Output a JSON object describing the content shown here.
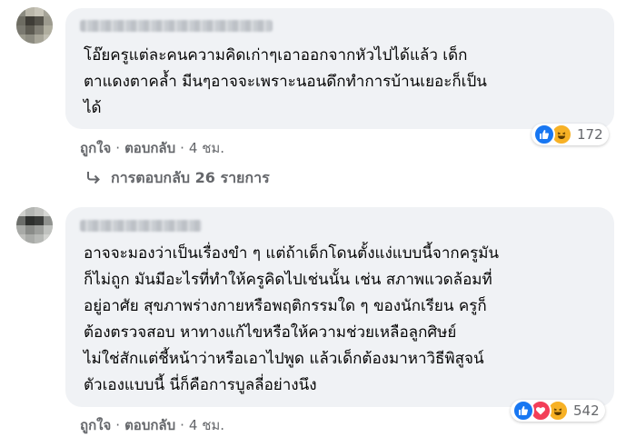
{
  "comments": [
    {
      "text": "โอ๊ยครูแต่ละคนความคิดเก่าๆเอาออกจากหัวไปได้แล้ว เด็ก\nตาแดงตาคล้ำ มีนๆอาจจะเพราะนอนดึกทำการบ้านเยอะก็เป็น\nได้",
      "like_label": "ถูกใจ",
      "reply_label": "ตอบกลับ",
      "time": "4 ชม.",
      "reaction_count": "172",
      "reactions": [
        "like-icon",
        "haha-icon"
      ]
    },
    {
      "text": "อาจจะมองว่าเป็นเรื่องขำ ๆ แต่ถ้าเด็กโดนตั้งแง่แบบนี้จากครูมัน\nก็ไม่ถูก มันมีอะไรที่ทำให้ครูคิดไปเช่นนั้น เช่น สภาพแวดล้อมที่\nอยู่อาศัย สุขภาพร่างกายหรือพฤติกรรมใด ๆ ของนักเรียน ครูก็\nต้องตรวจสอบ หาทางแก้ไขหรือให้ความช่วยเหลือลูกศิษย์\nไม่ใช่สักแต่ชี้หน้าว่าหรือเอาไปพูด แล้วเด็กต้องมาหาวิธีพิสูจน์\nตัวเองแบบนี้ นี่ก็คือการบูลลี่อย่างนึง",
      "like_label": "ถูกใจ",
      "reply_label": "ตอบกลับ",
      "time": "4 ชม.",
      "reaction_count": "542",
      "reactions": [
        "like-icon",
        "love-icon",
        "haha-icon"
      ]
    }
  ],
  "replies_link": "การตอบกลับ 26 รายการ",
  "colors": {
    "bubble": "#f0f2f5",
    "meta": "#65676b",
    "like": "#1877f2",
    "love": "#f33e58",
    "haha": "#f7b125"
  }
}
